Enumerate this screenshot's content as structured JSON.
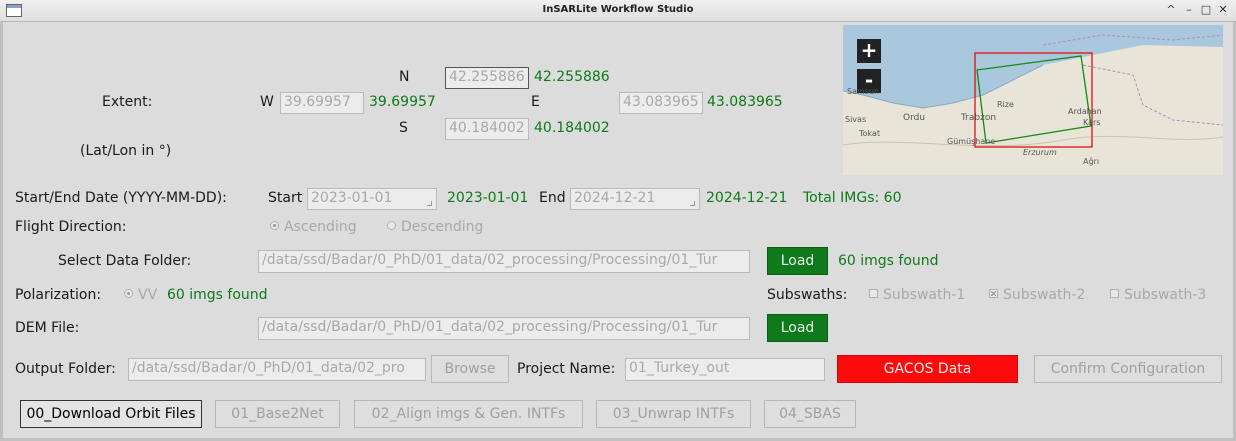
{
  "window": {
    "title": "InSARLite Workflow Studio",
    "controls": [
      "^",
      "–",
      "□",
      "✕"
    ]
  },
  "extent": {
    "label": "Extent:",
    "sublabel": "(Lat/Lon in °)",
    "n_label": "N",
    "n_value": "42.255886",
    "n_display": "42.255886",
    "w_label": "W",
    "w_value": "39.69957",
    "w_display": "39.69957",
    "e_label": "E",
    "e_value": "43.083965",
    "e_display": "43.083965",
    "s_label": "S",
    "s_value": "40.184002",
    "s_display": "40.184002"
  },
  "map": {
    "zoom_in": "+",
    "zoom_out": "-",
    "labels": [
      "Ordu",
      "Trabzon",
      "Rize",
      "Ardahan",
      "Kars",
      "Tokat",
      "Gümüşhane",
      "Erzurum",
      "Ağrı",
      "Samsun",
      "Sivas"
    ],
    "colors": {
      "aoi": "#e01010",
      "footprint": "#148a14",
      "sea": "#a9c7dd",
      "land": "#e9e4d8"
    }
  },
  "dates": {
    "label": "Start/End Date (YYYY-MM-DD):",
    "start_label": "Start",
    "start_value": "2023-01-01",
    "start_display": "2023-01-01",
    "end_label": "End",
    "end_value": "2024-12-21",
    "end_display": "2024-12-21",
    "total": "Total IMGs: 60"
  },
  "flight": {
    "label": "Flight Direction:",
    "ascending": "Ascending",
    "descending": "Descending"
  },
  "data_folder": {
    "label": "Select Data Folder:",
    "value": "/data/ssd/Badar/0_PhD/01_data/02_processing/Processing/01_Tur",
    "load": "Load",
    "status": "60 imgs found"
  },
  "polarization": {
    "label": "Polarization:",
    "option": "VV",
    "status": "60 imgs found"
  },
  "subswaths": {
    "label": "Subswaths:",
    "items": [
      "Subswath-1",
      "Subswath-2",
      "Subswath-3"
    ]
  },
  "dem": {
    "label": "DEM File:",
    "value": "/data/ssd/Badar/0_PhD/01_data/02_processing/Processing/01_Tur",
    "load": "Load"
  },
  "output": {
    "label": "Output Folder:",
    "value": "/data/ssd/Badar/0_PhD/01_data/02_pro",
    "browse": "Browse",
    "project_label": "Project Name:",
    "project_value": "01_Turkey_out",
    "gacos": "GACOS Data",
    "confirm": "Confirm Configuration"
  },
  "steps": [
    "00_Download Orbit Files",
    "01_Base2Net",
    "02_Align imgs & Gen. INTFs",
    "03_Unwrap INTFs",
    "04_SBAS"
  ]
}
